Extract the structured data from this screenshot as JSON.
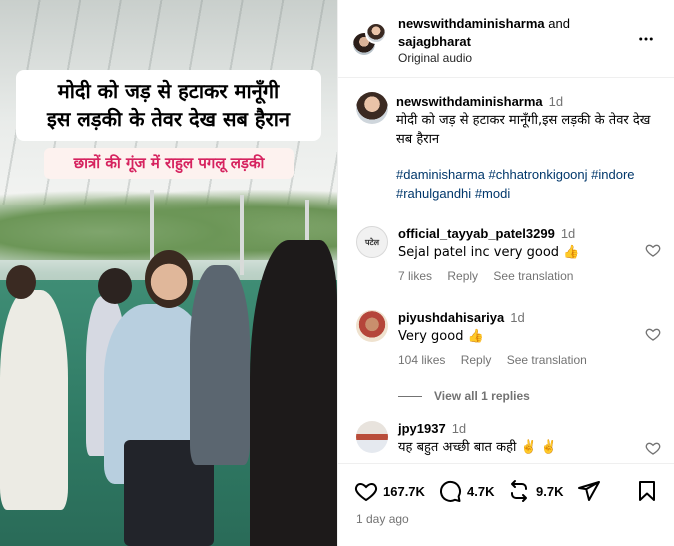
{
  "video": {
    "title_line1": "मोदी को जड़ से हटाकर मानूँगी",
    "title_line2": "इस लड़की के तेवर देख सब हैरान",
    "subtitle": "छात्रों की गूंज में राहुल पगलू लड़की"
  },
  "header": {
    "user1": "newswithdaminisharma",
    "and": "and",
    "user2": "sajagbharat",
    "audio": "Original audio",
    "more_icon": "more-horizontal-icon"
  },
  "caption": {
    "user": "newswithdaminisharma",
    "time": "1d",
    "text": "मोदी को जड़ से हटाकर मानूँगी,इस लड़की के तेवर देख सब हैरान",
    "tags": [
      "#daminisharma",
      "#chhatronkigoonj",
      "#indore",
      "#rahulgandhi",
      "#modi"
    ]
  },
  "comments": [
    {
      "user": "official_tayyab_patel3299",
      "time": "1d",
      "avatar_text": "पटेल",
      "text": "Sejal patel inc very good 👍",
      "likes": "7 likes",
      "reply": "Reply",
      "translate": "See translation"
    },
    {
      "user": "piyushdahisariya",
      "time": "1d",
      "text": "Very good 👍",
      "likes": "104 likes",
      "reply": "Reply",
      "translate": "See translation"
    },
    {
      "user": "jpy1937",
      "time": "1d",
      "text": "यह बहुत अच्छी बात कही ✌️ ✌️"
    }
  ],
  "view_replies": "View all 1 replies",
  "actions": {
    "likes": "167.7K",
    "comments": "4.7K",
    "reposts": "9.7K"
  },
  "date": "1 day ago",
  "colors": {
    "hashtag": "#00376b",
    "subtitle": "#d6235f",
    "muted": "#737373"
  }
}
